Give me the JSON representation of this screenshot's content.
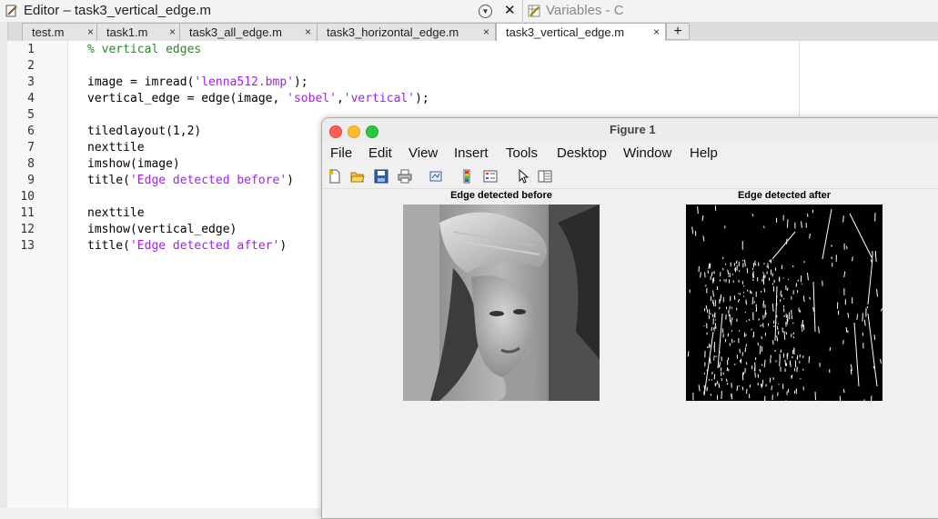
{
  "editor": {
    "title": "Editor – task3_vertical_edge.m",
    "variables_title": "Variables - C"
  },
  "tabs": [
    {
      "label": "test.m"
    },
    {
      "label": "task1.m"
    },
    {
      "label": "task3_all_edge.m"
    },
    {
      "label": "task3_horizontal_edge.m"
    },
    {
      "label": "task3_vertical_edge.m",
      "active": true
    }
  ],
  "tab_close_glyph": "×",
  "new_tab_glyph": "+",
  "code": [
    {
      "n": "1",
      "parts": [
        {
          "t": "% vertical edges",
          "c": "cmt"
        }
      ]
    },
    {
      "n": "2",
      "parts": []
    },
    {
      "n": "3",
      "parts": [
        {
          "t": "image = imread(",
          "c": ""
        },
        {
          "t": "'lenna512.bmp'",
          "c": "str"
        },
        {
          "t": ");",
          "c": ""
        }
      ]
    },
    {
      "n": "4",
      "parts": [
        {
          "t": "vertical_edge = edge(image, ",
          "c": ""
        },
        {
          "t": "'sobel'",
          "c": "str"
        },
        {
          "t": ",",
          "c": ""
        },
        {
          "t": "'vertical'",
          "c": "str"
        },
        {
          "t": ");",
          "c": ""
        }
      ]
    },
    {
      "n": "5",
      "parts": []
    },
    {
      "n": "6",
      "parts": [
        {
          "t": "tiledlayout(1,2)",
          "c": ""
        }
      ]
    },
    {
      "n": "7",
      "parts": [
        {
          "t": "nexttile",
          "c": ""
        }
      ]
    },
    {
      "n": "8",
      "parts": [
        {
          "t": "imshow(image)",
          "c": ""
        }
      ]
    },
    {
      "n": "9",
      "parts": [
        {
          "t": "title(",
          "c": ""
        },
        {
          "t": "'Edge detected before'",
          "c": "str"
        },
        {
          "t": ")",
          "c": ""
        }
      ]
    },
    {
      "n": "10",
      "parts": []
    },
    {
      "n": "11",
      "parts": [
        {
          "t": "nexttile",
          "c": ""
        }
      ]
    },
    {
      "n": "12",
      "parts": [
        {
          "t": "imshow(vertical_edge)",
          "c": ""
        }
      ]
    },
    {
      "n": "13",
      "parts": [
        {
          "t": "title(",
          "c": ""
        },
        {
          "t": "'Edge detected after'",
          "c": "str"
        },
        {
          "t": ")",
          "c": ""
        }
      ]
    }
  ],
  "figure": {
    "title": "Figure 1",
    "menu": [
      "File",
      "Edit",
      "View",
      "Insert",
      "Tools",
      "Desktop",
      "Window",
      "Help"
    ],
    "toolbar": [
      "new-figure-icon",
      "open-file-icon",
      "save-icon",
      "print-icon",
      "link-plot-icon",
      "insert-colorbar-icon",
      "insert-legend-icon",
      "edit-plot-pointer-icon",
      "property-inspector-icon"
    ],
    "plots": [
      {
        "title": "Edge detected before",
        "image": "grayscale-portrait"
      },
      {
        "title": "Edge detected after",
        "image": "vertical-edge-map"
      }
    ]
  },
  "colors": {
    "comment": "#228b22",
    "string": "#a020f0",
    "close": "#ff5f57",
    "minimize": "#febc2e",
    "maximize": "#28c840"
  }
}
